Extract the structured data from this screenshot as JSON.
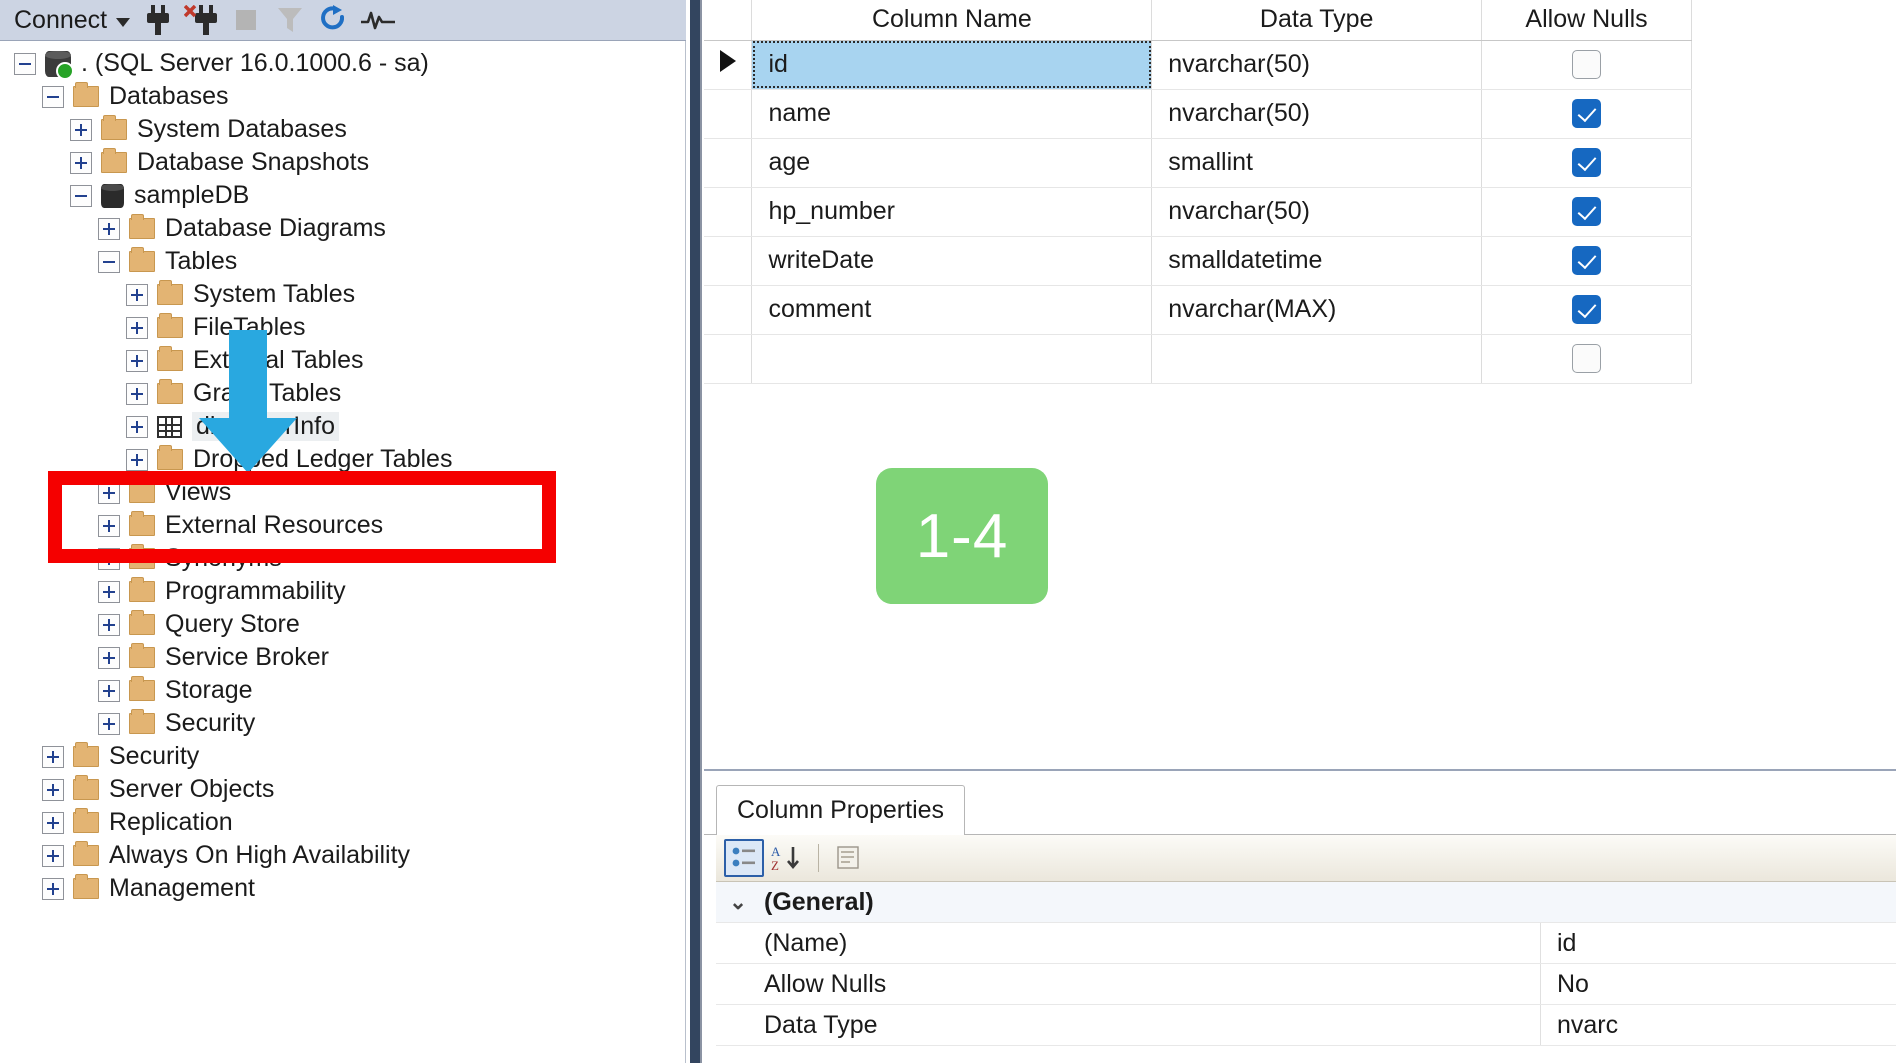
{
  "object_explorer": {
    "toolbar": {
      "connect_label": "Connect",
      "icons": [
        {
          "name": "connect-plug-icon"
        },
        {
          "name": "disconnect-plug-icon"
        },
        {
          "name": "stop-icon"
        },
        {
          "name": "filter-icon"
        },
        {
          "name": "refresh-icon"
        },
        {
          "name": "activity-monitor-icon"
        }
      ]
    },
    "tree": [
      {
        "label": ". (SQL Server 16.0.1000.6 - sa)",
        "indent": 0,
        "state": "minus",
        "icon": "server"
      },
      {
        "label": "Databases",
        "indent": 1,
        "state": "minus",
        "icon": "folder"
      },
      {
        "label": "System Databases",
        "indent": 2,
        "state": "plus",
        "icon": "folder"
      },
      {
        "label": "Database Snapshots",
        "indent": 2,
        "state": "plus",
        "icon": "folder"
      },
      {
        "label": "sampleDB",
        "indent": 2,
        "state": "minus",
        "icon": "database"
      },
      {
        "label": "Database Diagrams",
        "indent": 3,
        "state": "plus",
        "icon": "folder"
      },
      {
        "label": "Tables",
        "indent": 3,
        "state": "minus",
        "icon": "folder"
      },
      {
        "label": "System Tables",
        "indent": 4,
        "state": "plus",
        "icon": "folder"
      },
      {
        "label": "FileTables",
        "indent": 4,
        "state": "plus",
        "icon": "folder"
      },
      {
        "label": "External Tables",
        "indent": 4,
        "state": "plus",
        "icon": "folder"
      },
      {
        "label": "Graph Tables",
        "indent": 4,
        "state": "plus",
        "icon": "folder"
      },
      {
        "label": "dbo.userInfo",
        "indent": 4,
        "state": "plus",
        "icon": "table",
        "hover": true
      },
      {
        "label": "Dropped Ledger Tables",
        "indent": 4,
        "state": "plus",
        "icon": "folder"
      },
      {
        "label": "Views",
        "indent": 3,
        "state": "plus",
        "icon": "folder"
      },
      {
        "label": "External Resources",
        "indent": 3,
        "state": "plus",
        "icon": "folder"
      },
      {
        "label": "Synonyms",
        "indent": 3,
        "state": "plus",
        "icon": "folder"
      },
      {
        "label": "Programmability",
        "indent": 3,
        "state": "plus",
        "icon": "folder"
      },
      {
        "label": "Query Store",
        "indent": 3,
        "state": "plus",
        "icon": "folder"
      },
      {
        "label": "Service Broker",
        "indent": 3,
        "state": "plus",
        "icon": "folder"
      },
      {
        "label": "Storage",
        "indent": 3,
        "state": "plus",
        "icon": "folder"
      },
      {
        "label": "Security",
        "indent": 3,
        "state": "plus",
        "icon": "folder"
      },
      {
        "label": "Security",
        "indent": 1,
        "state": "plus",
        "icon": "folder"
      },
      {
        "label": "Server Objects",
        "indent": 1,
        "state": "plus",
        "icon": "folder"
      },
      {
        "label": "Replication",
        "indent": 1,
        "state": "plus",
        "icon": "folder"
      },
      {
        "label": "Always On High Availability",
        "indent": 1,
        "state": "plus",
        "icon": "folder"
      },
      {
        "label": "Management",
        "indent": 1,
        "state": "plus",
        "icon": "folder"
      }
    ]
  },
  "designer": {
    "headers": {
      "column_name": "Column Name",
      "data_type": "Data Type",
      "allow_nulls": "Allow Nulls"
    },
    "rows": [
      {
        "name": "id",
        "type": "nvarchar(50)",
        "allow_nulls": false,
        "selected": true
      },
      {
        "name": "name",
        "type": "nvarchar(50)",
        "allow_nulls": true,
        "selected": false
      },
      {
        "name": "age",
        "type": "smallint",
        "allow_nulls": true,
        "selected": false
      },
      {
        "name": "hp_number",
        "type": "nvarchar(50)",
        "allow_nulls": true,
        "selected": false
      },
      {
        "name": "writeDate",
        "type": "smalldatetime",
        "allow_nulls": true,
        "selected": false
      },
      {
        "name": "comment",
        "type": "nvarchar(MAX)",
        "allow_nulls": true,
        "selected": false
      },
      {
        "name": "",
        "type": "",
        "allow_nulls": false,
        "selected": false
      }
    ]
  },
  "column_properties": {
    "tab_label": "Column Properties",
    "toolbar": [
      {
        "name": "categorized-view-icon",
        "active": true
      },
      {
        "name": "alphabetical-sort-icon",
        "active": false
      },
      {
        "name": "property-pages-icon",
        "active": false
      }
    ],
    "rows": [
      {
        "key": "(General)",
        "value": "",
        "group": true
      },
      {
        "key": "(Name)",
        "value": "id",
        "group": false
      },
      {
        "key": "Allow Nulls",
        "value": "No",
        "group": false
      },
      {
        "key": "Data Type",
        "value": "nvarc",
        "group": false
      }
    ]
  },
  "annotations": {
    "step_badge": "1-4",
    "badge_color": "#7fd477",
    "highlight_color": "#f50000",
    "arrow_color": "#29a8e0"
  }
}
